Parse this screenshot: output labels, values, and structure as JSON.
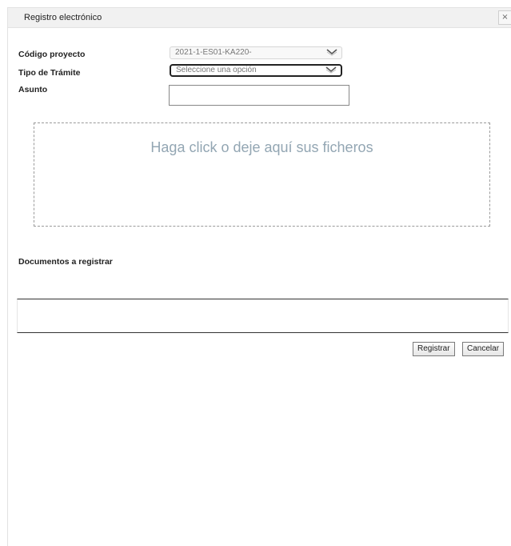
{
  "dialog": {
    "title": "Registro electrónico",
    "close_symbol": "×"
  },
  "form": {
    "codigo_label": "Código proyecto",
    "codigo_value": "2021-1-ES01-KA220-",
    "tipo_label": "Tipo de Trámite",
    "tipo_value": "Seleccione una opción",
    "asunto_label": "Asunto",
    "asunto_value": ""
  },
  "dropzone": {
    "text": "Haga click o deje aquí sus ficheros"
  },
  "documents": {
    "heading": "Documentos a registrar",
    "rows": []
  },
  "buttons": {
    "register": "Registrar",
    "cancel": "Cancelar"
  },
  "icons": {
    "close": "close-icon",
    "dropdown": "chevron-down-icon"
  }
}
